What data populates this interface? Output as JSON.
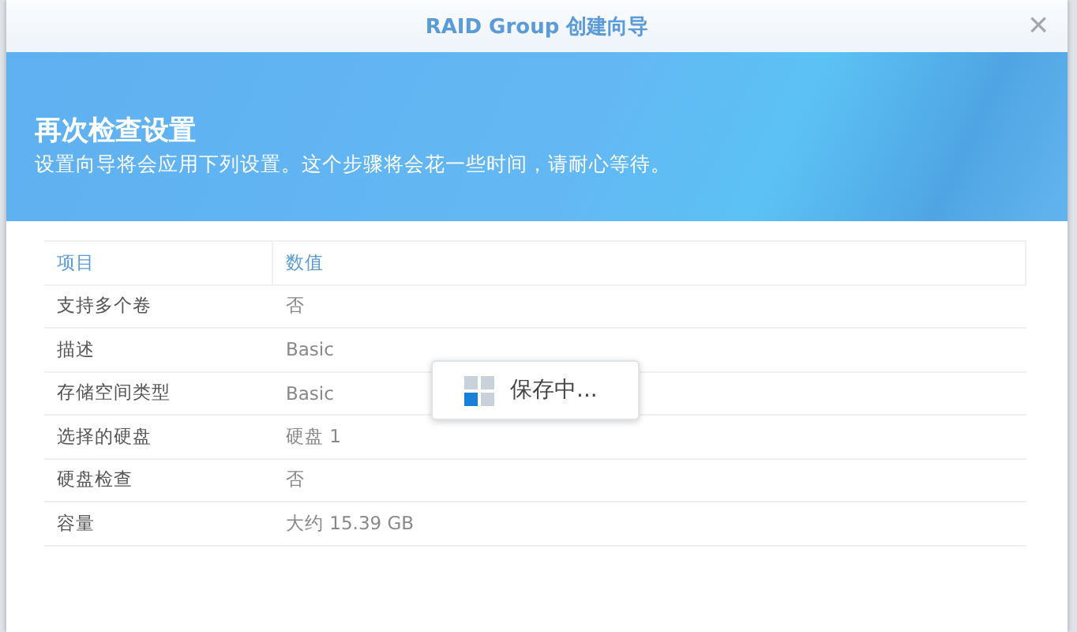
{
  "window": {
    "title": "RAID Group 创建向导",
    "close": "×"
  },
  "banner": {
    "heading": "再次检查设置",
    "description": "设置向导将会应用下列设置。这个步骤将会花一些时间，请耐心等待。"
  },
  "table": {
    "columns": [
      "项目",
      "数值"
    ],
    "rows": [
      {
        "item": "支持多个卷",
        "value": "否"
      },
      {
        "item": "描述",
        "value": "Basic"
      },
      {
        "item": "存储空间类型",
        "value": "Basic"
      },
      {
        "item": "选择的硬盘",
        "value": "硬盘 1"
      },
      {
        "item": "硬盘检查",
        "value": "否"
      },
      {
        "item": "容量",
        "value": "大约 15.39 GB"
      }
    ]
  },
  "toast": {
    "text": "保存中..."
  }
}
